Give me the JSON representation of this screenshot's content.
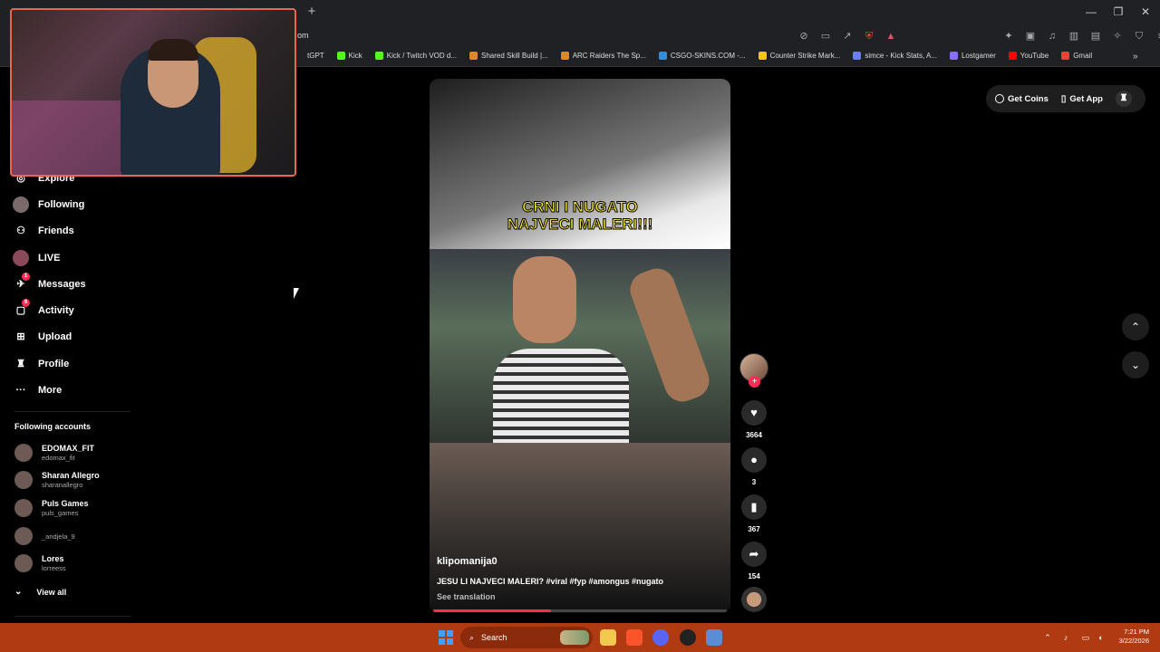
{
  "browser": {
    "new_tab": "+",
    "address": "om",
    "win_min": "—",
    "win_max": "❐",
    "win_close": "✕",
    "bookmarks": [
      {
        "label": "tGPT",
        "color": "#202124"
      },
      {
        "label": "Kick",
        "color": "#53fc18"
      },
      {
        "label": "Kick / Twitch VOD d...",
        "color": "#53fc18"
      },
      {
        "label": "Shared Skill Build |...",
        "color": "#e0862b"
      },
      {
        "label": "ARC Raiders The Sp...",
        "color": "#e0862b"
      },
      {
        "label": "CSGO-SKINS.COM -...",
        "color": "#2f8fdd"
      },
      {
        "label": "Counter Strike Mark...",
        "color": "#f5c518"
      },
      {
        "label": "simce - Kick Stats, A...",
        "color": "#6b7cff"
      },
      {
        "label": "Lostgamer",
        "color": "#8a6cff"
      },
      {
        "label": "YouTube",
        "color": "#ff0000"
      },
      {
        "label": "Gmail",
        "color": "#ea4335"
      }
    ],
    "bookmarks_more": "»"
  },
  "sidebar": {
    "items": [
      {
        "label": "Explore",
        "icon": "compass-icon",
        "glyph": "◎"
      },
      {
        "label": "Following",
        "icon": "following-avatar-icon",
        "glyph": ""
      },
      {
        "label": "Friends",
        "icon": "friends-icon",
        "glyph": "⚇"
      },
      {
        "label": "LIVE",
        "icon": "live-icon",
        "glyph": ""
      },
      {
        "label": "Messages",
        "icon": "messages-icon",
        "glyph": "✈",
        "badge": "1"
      },
      {
        "label": "Activity",
        "icon": "activity-icon",
        "glyph": "▢",
        "badge": "6"
      },
      {
        "label": "Upload",
        "icon": "upload-icon",
        "glyph": "⊞"
      },
      {
        "label": "Profile",
        "icon": "profile-icon",
        "glyph": "♜"
      },
      {
        "label": "More",
        "icon": "more-icon",
        "glyph": "···"
      }
    ],
    "following_title": "Following accounts",
    "accounts": [
      {
        "name": "EDOMAX_FIT",
        "handle": "edomax_fit"
      },
      {
        "name": "Sharan Allegro",
        "handle": "sharanallegro"
      },
      {
        "name": "Puls Games",
        "handle": "puls_games"
      },
      {
        "name": "",
        "handle": "_andjela_9"
      },
      {
        "name": "Lores",
        "handle": "lorreess"
      }
    ],
    "view_all": "View all"
  },
  "header": {
    "get_coins": "Get Coins",
    "get_app": "Get App"
  },
  "video": {
    "overlay_title_line1": "CRNI I NUGATO",
    "overlay_title_line2": "NAJVECI MALERI!!!",
    "author": "klipomanija0",
    "caption": "JESU LI NAJVECI MALERI? #viral #fyp #amongus #nugato",
    "see_translation": "See translation",
    "progress": 0.4
  },
  "actions": {
    "likes": "3664",
    "comments": "3",
    "saves": "367",
    "shares": "154"
  },
  "taskbar": {
    "search_placeholder": "Search",
    "time": "7:21 PM",
    "date": "3/22/2026"
  },
  "colors": {
    "accent": "#fe2c55",
    "overlay_text": "#ffef2a",
    "taskbar": "#b03a12",
    "webcam_border": "#e8674d"
  }
}
